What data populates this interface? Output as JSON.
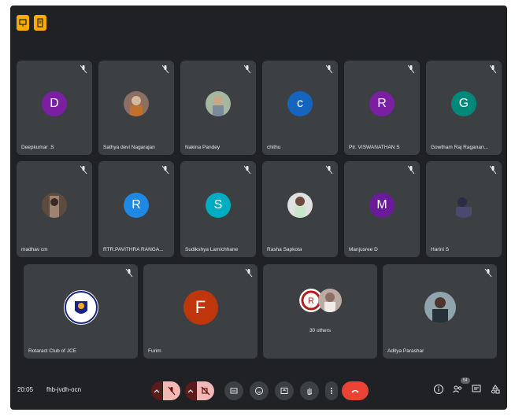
{
  "colors": {
    "background": "#202124",
    "tile": "#3c4043",
    "end_call": "#ea4335",
    "muted_button": "#5c1b1b",
    "toolbar_button": "#3c4043"
  },
  "top_icons": [
    "presentation-icon",
    "document-icon"
  ],
  "participants_row1": [
    {
      "name": "Deepkumar .S",
      "initial": "D",
      "color": "#7b1fa2"
    },
    {
      "name": "Sathya devi Nagarajan",
      "photo": true
    },
    {
      "name": "Nakina Pandey",
      "photo": true
    },
    {
      "name": "chithu",
      "initial": "c",
      "color": "#1565c0"
    },
    {
      "name": "Ptr. VISWANATHAN S",
      "initial": "R",
      "color": "#7b1fa2"
    },
    {
      "name": "Gowtham Raj Raganan...",
      "initial": "G",
      "color": "#00897b"
    }
  ],
  "participants_row2": [
    {
      "name": "madhav cm",
      "photo": true
    },
    {
      "name": "RTR.PAVITHRA RANGA...",
      "initial": "R",
      "color": "#1e88e5"
    },
    {
      "name": "Sudikshya Lamichhane",
      "initial": "S",
      "color": "#00acc1"
    },
    {
      "name": "Rasha Sapkota",
      "photo": true
    },
    {
      "name": "Manjusree D",
      "initial": "M",
      "color": "#6a1b9a"
    },
    {
      "name": "Harini S",
      "photo": true
    }
  ],
  "participants_row3": [
    {
      "name": "Rotaract Club of JCE",
      "logo": true
    },
    {
      "name": "Furim",
      "initial": "F",
      "color": "#bf360c"
    },
    {
      "name": "30 others"
    },
    {
      "name": "Aditya Parashar",
      "photo": true
    }
  ],
  "bottom_bar": {
    "time": "20:05",
    "meeting_code": "fhb-jvdh-ocn",
    "participant_count": "54"
  }
}
